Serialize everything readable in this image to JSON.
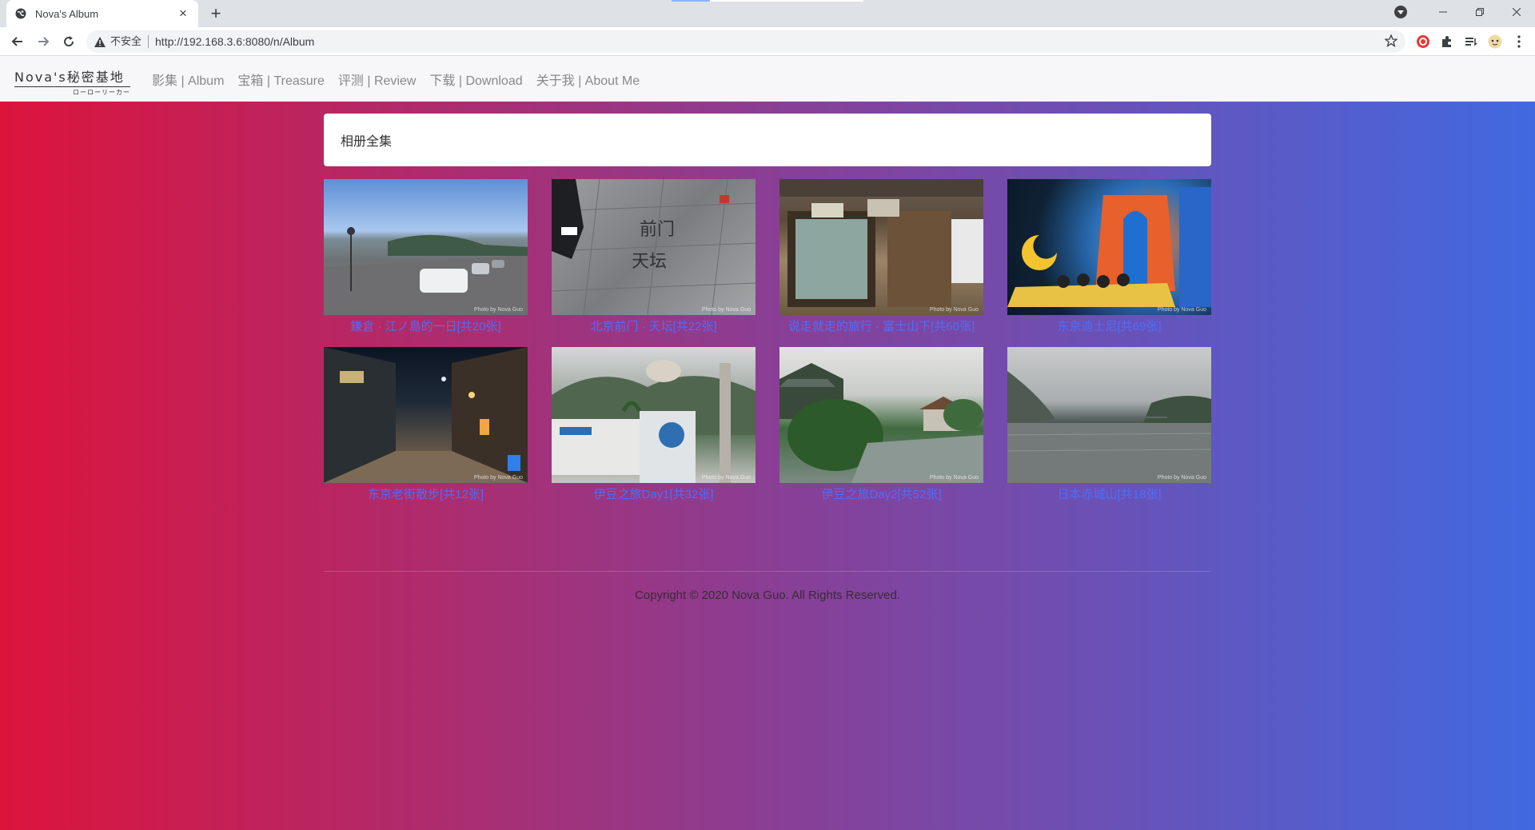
{
  "browser": {
    "tab_title": "Nova's Album",
    "tab_close": "×",
    "new_tab": "+",
    "security_label": "不安全",
    "url": "http://192.168.3.6:8080/n/Album"
  },
  "site": {
    "brand_main": "Nova's秘密基地",
    "brand_sub": "ローローリーカー",
    "nav": [
      {
        "label": "影集 | Album"
      },
      {
        "label": "宝箱 | Treasure"
      },
      {
        "label": "评测 | Review"
      },
      {
        "label": "下载 | Download"
      },
      {
        "label": "关于我 | About Me"
      }
    ]
  },
  "main": {
    "card_title": "相册全集",
    "albums": [
      {
        "caption": "鎌倉 · 江ノ島的一日[共20张]"
      },
      {
        "caption": "北京前门 · 天坛[共22张]"
      },
      {
        "caption": "说走就走的旅行 - 富士山下[共60张]"
      },
      {
        "caption": "东京迪士尼[共69张]"
      },
      {
        "caption": "东京老街散步[共12张]"
      },
      {
        "caption": "伊豆之旅Day1[共32张]"
      },
      {
        "caption": "伊豆之旅Day2[共52张]"
      },
      {
        "caption": "日本赤城山[共18张]"
      }
    ],
    "watermark": "Photo by Nova Guo"
  },
  "footer": {
    "text": "Copyright © 2020 Nova Guo. All Rights Reserved."
  },
  "colors": {
    "gradient_start": "#dc143c",
    "gradient_end": "#4169e1",
    "caption_link": "#4f6ef7"
  }
}
